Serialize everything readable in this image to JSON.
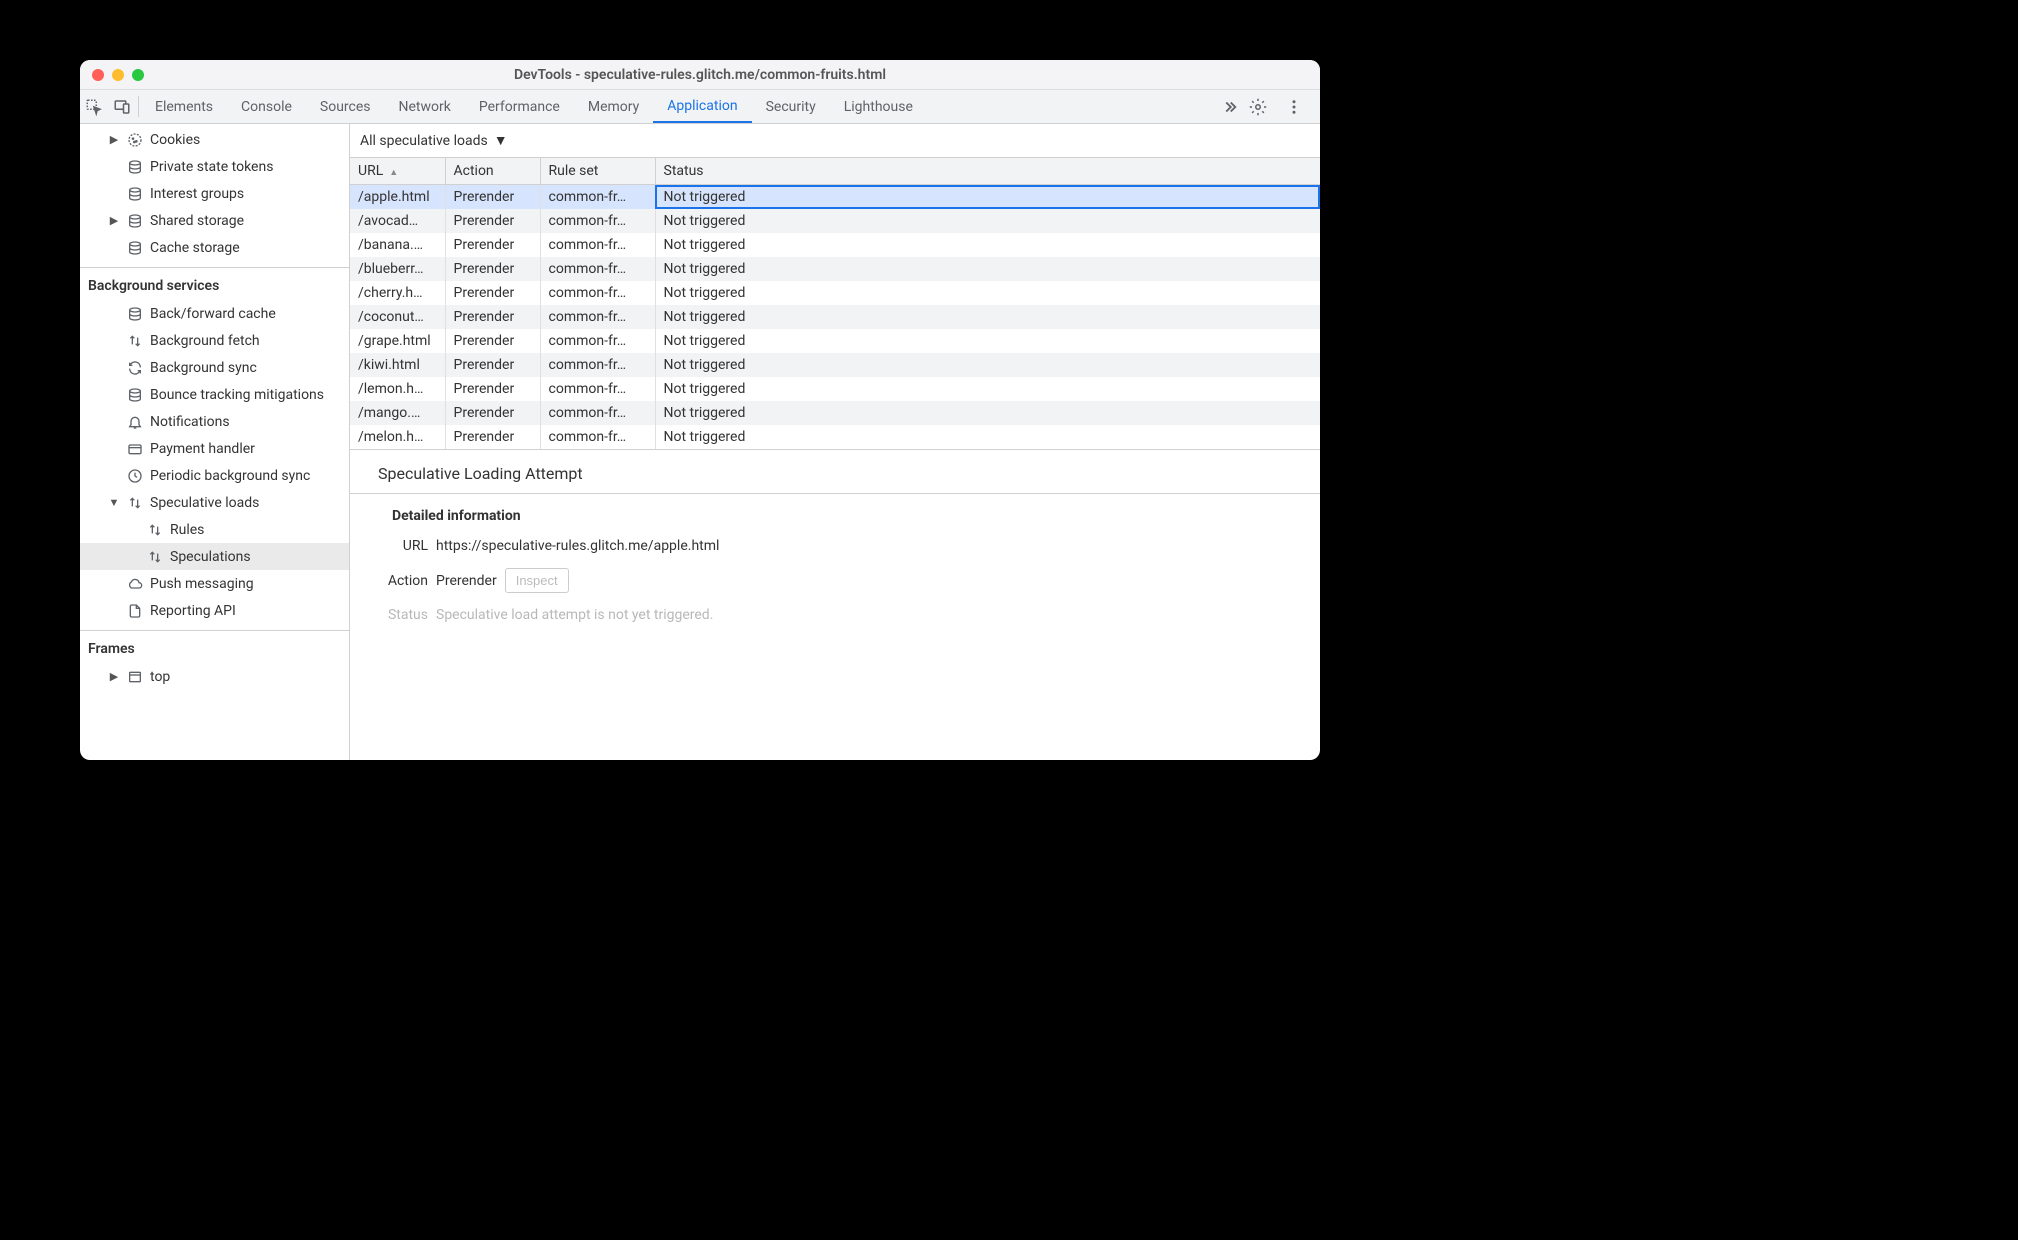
{
  "window": {
    "title": "DevTools - speculative-rules.glitch.me/common-fruits.html"
  },
  "tabs": {
    "items": [
      {
        "label": "Elements",
        "active": false
      },
      {
        "label": "Console",
        "active": false
      },
      {
        "label": "Sources",
        "active": false
      },
      {
        "label": "Network",
        "active": false
      },
      {
        "label": "Performance",
        "active": false
      },
      {
        "label": "Memory",
        "active": false
      },
      {
        "label": "Application",
        "active": true
      },
      {
        "label": "Security",
        "active": false
      },
      {
        "label": "Lighthouse",
        "active": false
      }
    ]
  },
  "sidebar": {
    "storage_items": [
      {
        "label": "Cookies",
        "icon": "cookie",
        "expandable": true
      },
      {
        "label": "Private state tokens",
        "icon": "db"
      },
      {
        "label": "Interest groups",
        "icon": "db"
      },
      {
        "label": "Shared storage",
        "icon": "db",
        "expandable": true
      },
      {
        "label": "Cache storage",
        "icon": "db"
      }
    ],
    "bg_heading": "Background services",
    "bg_items": [
      {
        "label": "Back/forward cache",
        "icon": "db"
      },
      {
        "label": "Background fetch",
        "icon": "updown"
      },
      {
        "label": "Background sync",
        "icon": "sync"
      },
      {
        "label": "Bounce tracking mitigations",
        "icon": "db"
      },
      {
        "label": "Notifications",
        "icon": "bell"
      },
      {
        "label": "Payment handler",
        "icon": "card"
      },
      {
        "label": "Periodic background sync",
        "icon": "clock"
      },
      {
        "label": "Speculative loads",
        "icon": "updown",
        "expanded": true,
        "children": [
          {
            "label": "Rules",
            "icon": "updown"
          },
          {
            "label": "Speculations",
            "icon": "updown",
            "selected": true
          }
        ]
      },
      {
        "label": "Push messaging",
        "icon": "cloud"
      },
      {
        "label": "Reporting API",
        "icon": "page"
      }
    ],
    "frames_heading": "Frames",
    "frames_items": [
      {
        "label": "top",
        "icon": "frame",
        "expandable": true
      }
    ]
  },
  "filter": {
    "label": "All speculative loads"
  },
  "table": {
    "headers": {
      "url": "URL",
      "action": "Action",
      "ruleset": "Rule set",
      "status": "Status"
    },
    "rows": [
      {
        "url": "/apple.html",
        "action": "Prerender",
        "ruleset": "common-fr…",
        "status": "Not triggered",
        "selected": true
      },
      {
        "url": "/avocad…",
        "action": "Prerender",
        "ruleset": "common-fr…",
        "status": "Not triggered"
      },
      {
        "url": "/banana.…",
        "action": "Prerender",
        "ruleset": "common-fr…",
        "status": "Not triggered"
      },
      {
        "url": "/blueberr…",
        "action": "Prerender",
        "ruleset": "common-fr…",
        "status": "Not triggered"
      },
      {
        "url": "/cherry.h…",
        "action": "Prerender",
        "ruleset": "common-fr…",
        "status": "Not triggered"
      },
      {
        "url": "/coconut…",
        "action": "Prerender",
        "ruleset": "common-fr…",
        "status": "Not triggered"
      },
      {
        "url": "/grape.html",
        "action": "Prerender",
        "ruleset": "common-fr…",
        "status": "Not triggered"
      },
      {
        "url": "/kiwi.html",
        "action": "Prerender",
        "ruleset": "common-fr…",
        "status": "Not triggered"
      },
      {
        "url": "/lemon.h…",
        "action": "Prerender",
        "ruleset": "common-fr…",
        "status": "Not triggered"
      },
      {
        "url": "/mango.…",
        "action": "Prerender",
        "ruleset": "common-fr…",
        "status": "Not triggered"
      },
      {
        "url": "/melon.h…",
        "action": "Prerender",
        "ruleset": "common-fr…",
        "status": "Not triggered"
      }
    ]
  },
  "details": {
    "heading": "Speculative Loading Attempt",
    "info_heading": "Detailed information",
    "url_label": "URL",
    "url_value": "https://speculative-rules.glitch.me/apple.html",
    "action_label": "Action",
    "action_value": "Prerender",
    "inspect_label": "Inspect",
    "status_label": "Status",
    "status_value": "Speculative load attempt is not yet triggered."
  }
}
